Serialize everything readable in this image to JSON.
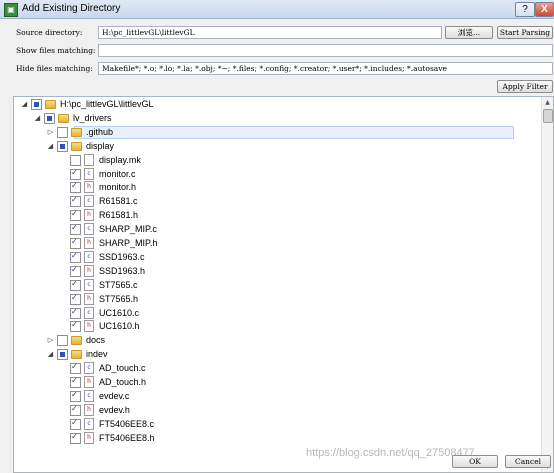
{
  "window": {
    "title": "Add Existing Directory",
    "help_label": "?",
    "close_label": "X"
  },
  "source": {
    "label": "Source directory:",
    "value": "H:\\pc_littlevGL\\littlevGL",
    "browse_label": "浏览...",
    "start_label": "Start Parsing"
  },
  "show": {
    "label": "Show files matching:",
    "value": ""
  },
  "hide": {
    "label": "Hide files matching:",
    "value": "Makefile*; *.o; *.lo; *.la; *.obj; *~; *.files; *.config; *.creator; *.user*; *.includes; *.autosave"
  },
  "apply_label": "Apply Filter",
  "tree": [
    {
      "name": "H:\\pc_littlevGL\\littlevGL",
      "type": "folder",
      "check": "partial",
      "expand": "open"
    },
    {
      "name": "lv_drivers",
      "type": "folder",
      "check": "partial",
      "expand": "open"
    },
    {
      "name": ".github",
      "type": "folder",
      "check": "unchecked",
      "expand": "closed"
    },
    {
      "name": "display",
      "type": "folder",
      "check": "partial",
      "expand": "open"
    },
    {
      "name": "display.mk",
      "type": "file",
      "check": "unchecked",
      "expand": ""
    },
    {
      "name": "monitor.c",
      "type": "c",
      "check": "checked",
      "expand": ""
    },
    {
      "name": "monitor.h",
      "type": "h",
      "check": "checked",
      "expand": ""
    },
    {
      "name": "R61581.c",
      "type": "c",
      "check": "checked",
      "expand": ""
    },
    {
      "name": "R61581.h",
      "type": "h",
      "check": "checked",
      "expand": ""
    },
    {
      "name": "SHARP_MIP.c",
      "type": "c",
      "check": "checked",
      "expand": ""
    },
    {
      "name": "SHARP_MIP.h",
      "type": "h",
      "check": "checked",
      "expand": ""
    },
    {
      "name": "SSD1963.c",
      "type": "c",
      "check": "checked",
      "expand": ""
    },
    {
      "name": "SSD1963.h",
      "type": "h",
      "check": "checked",
      "expand": ""
    },
    {
      "name": "ST7565.c",
      "type": "c",
      "check": "checked",
      "expand": ""
    },
    {
      "name": "ST7565.h",
      "type": "h",
      "check": "checked",
      "expand": ""
    },
    {
      "name": "UC1610.c",
      "type": "c",
      "check": "checked",
      "expand": ""
    },
    {
      "name": "UC1610.h",
      "type": "h",
      "check": "checked",
      "expand": ""
    },
    {
      "name": "docs",
      "type": "folder",
      "check": "unchecked",
      "expand": "closed"
    },
    {
      "name": "indev",
      "type": "folder",
      "check": "partial",
      "expand": "open"
    },
    {
      "name": "AD_touch.c",
      "type": "c",
      "check": "checked",
      "expand": ""
    },
    {
      "name": "AD_touch.h",
      "type": "h",
      "check": "checked",
      "expand": ""
    },
    {
      "name": "evdev.c",
      "type": "c",
      "check": "checked",
      "expand": ""
    },
    {
      "name": "evdev.h",
      "type": "h",
      "check": "checked",
      "expand": ""
    },
    {
      "name": "FT5406EE8.c",
      "type": "c",
      "check": "checked",
      "expand": ""
    },
    {
      "name": "FT5406EE8.h",
      "type": "h",
      "check": "checked",
      "expand": ""
    }
  ],
  "ok_label": "OK",
  "cancel_label": "Cancel",
  "watermark": "https://blog.csdn.net/qq_27508477"
}
